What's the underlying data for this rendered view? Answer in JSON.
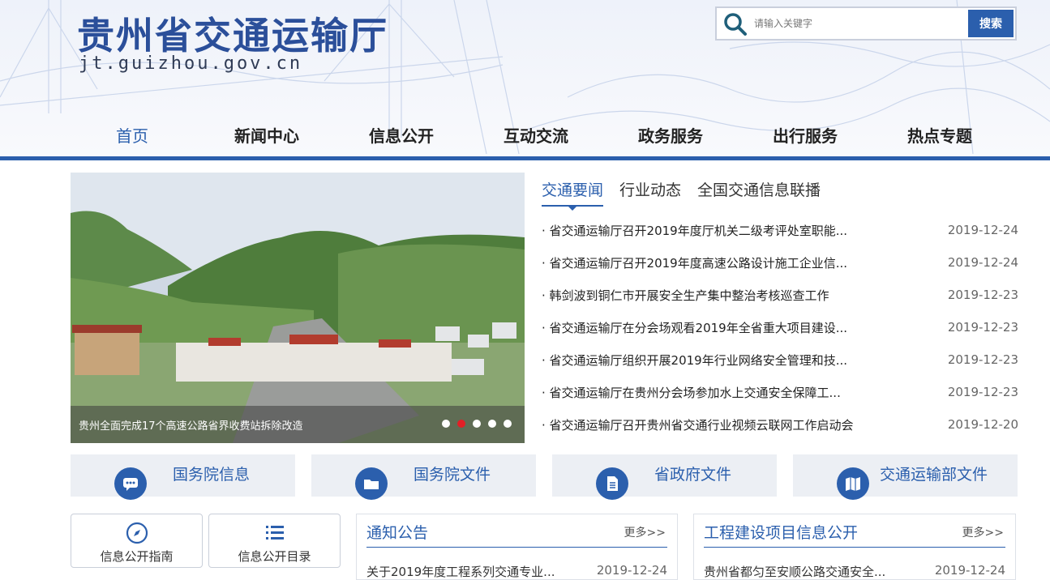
{
  "header": {
    "title": "贵州省交通运输厅",
    "domain": "jt.guizhou.gov.cn",
    "search_placeholder": "请输入关键字",
    "search_button": "搜索"
  },
  "nav": {
    "items": [
      {
        "label": "首页",
        "active": true
      },
      {
        "label": "新闻中心"
      },
      {
        "label": "信息公开"
      },
      {
        "label": "互动交流"
      },
      {
        "label": "政务服务"
      },
      {
        "label": "出行服务"
      },
      {
        "label": "热点专题"
      }
    ]
  },
  "carousel": {
    "caption": "贵州全面完成17个高速公路省界收费站拆除改造",
    "dots": 5,
    "active_dot": 2
  },
  "news": {
    "tabs": [
      "交通要闻",
      "行业动态",
      "全国交通信息联播"
    ],
    "active_tab": 0,
    "items": [
      {
        "title": "· 省交通运输厅召开2019年度厅机关二级考评处室职能...",
        "date": "2019-12-24"
      },
      {
        "title": "· 省交通运输厅召开2019年度高速公路设计施工企业信...",
        "date": "2019-12-24"
      },
      {
        "title": "· 韩剑波到铜仁市开展安全生产集中整治考核巡查工作",
        "date": "2019-12-23"
      },
      {
        "title": "· 省交通运输厅在分会场观看2019年全省重大项目建设...",
        "date": "2019-12-23"
      },
      {
        "title": "· 省交通运输厅组织开展2019年行业网络安全管理和技...",
        "date": "2019-12-23"
      },
      {
        "title": "· 省交通运输厅在贵州分会场参加水上交通安全保障工...",
        "date": "2019-12-23"
      },
      {
        "title": "· 省交通运输厅召开贵州省交通行业视频云联网工作启动会",
        "date": "2019-12-20"
      }
    ]
  },
  "quick_links": [
    {
      "label": "国务院信息",
      "icon": "chat-icon"
    },
    {
      "label": "国务院文件",
      "icon": "folder-icon"
    },
    {
      "label": "省政府文件",
      "icon": "document-icon"
    },
    {
      "label": "交通运输部文件",
      "icon": "map-book-icon"
    }
  ],
  "info_buttons": [
    {
      "label": "信息公开指南",
      "icon": "compass-icon"
    },
    {
      "label": "信息公开目录",
      "icon": "list-icon"
    }
  ],
  "panels": [
    {
      "title": "通知公告",
      "more": "更多>>",
      "row_title": "关于2019年度工程系列交通专业...",
      "row_date": "2019-12-24"
    },
    {
      "title": "工程建设项目信息公开",
      "more": "更多>>",
      "row_title": "贵州省都匀至安顺公路交通安全...",
      "row_date": "2019-12-24"
    }
  ],
  "colors": {
    "brand_blue": "#2b5fad",
    "active_dot": "#e21f26"
  }
}
